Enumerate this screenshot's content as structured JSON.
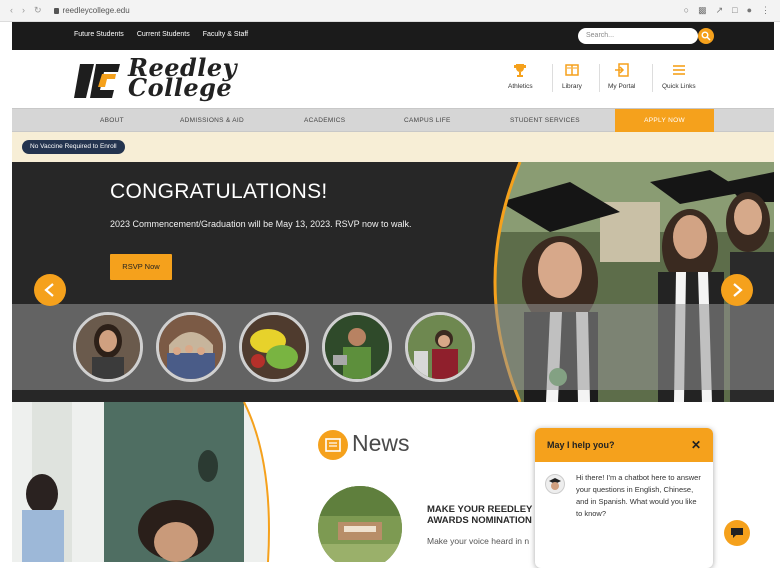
{
  "browser": {
    "url": "reedleycollege.edu"
  },
  "topbar": {
    "links": [
      "Future Students",
      "Current Students",
      "Faculty & Staff"
    ],
    "search_placeholder": "Search..."
  },
  "header": {
    "logo_line1": "Reedley",
    "logo_line2": "College",
    "quick_links": [
      {
        "label": "Athletics",
        "icon": "trophy-icon"
      },
      {
        "label": "Library",
        "icon": "library-icon"
      },
      {
        "label": "My Portal",
        "icon": "portal-icon"
      },
      {
        "label": "Quick Links",
        "icon": "menu-icon"
      }
    ]
  },
  "nav": {
    "items": [
      "ABOUT",
      "ADMISSIONS & AID",
      "ACADEMICS",
      "CAMPUS LIFE",
      "STUDENT SERVICES"
    ],
    "apply_label": "APPLY NOW"
  },
  "alert": {
    "pill_text": "No Vaccine Required to Enroll"
  },
  "hero": {
    "title": "CONGRATULATIONS!",
    "subtitle": "2023 Commencement/Graduation will be May 13, 2023. RSVP now to walk.",
    "cta_label": "RSVP Now"
  },
  "news": {
    "heading": "News",
    "headline": "MAKE YOUR REEDLEY AWARDS NOMINATION",
    "excerpt": "Make your voice heard in n"
  },
  "chat": {
    "header": "May I help you?",
    "close": "✕",
    "message": "Hi there! I'm a chatbot here to answer your questions in English, Chinese, and in Spanish. What would you like to know?"
  },
  "colors": {
    "accent": "#f5a11c",
    "topbar": "#1b1b1b",
    "hero_bg": "#272727",
    "alert_bg": "#f7eed6",
    "pill_bg": "#24344f"
  }
}
